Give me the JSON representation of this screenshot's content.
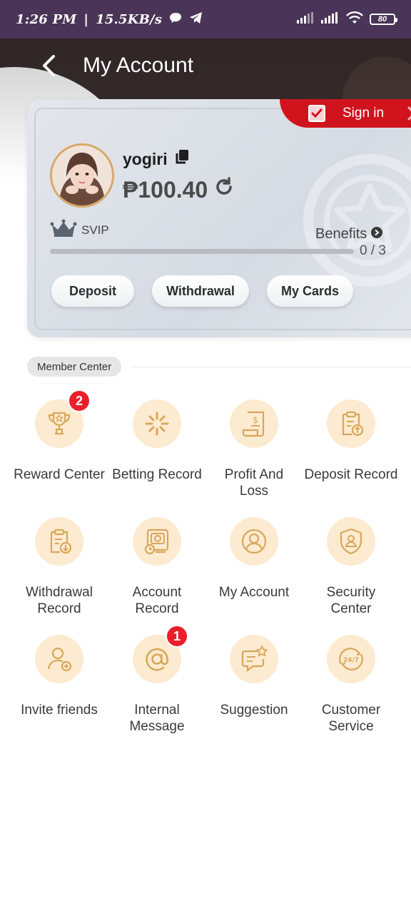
{
  "status_bar": {
    "time": "1:26 PM",
    "separator": "|",
    "speed": "15.5KB/s",
    "battery": "80"
  },
  "header": {
    "title": "My Account"
  },
  "card": {
    "sign_in": "Sign in",
    "username": "yogiri",
    "balance": "₱100.40",
    "vip_level": "SVIP",
    "benefits_label": "Benefits",
    "progress_text": "0 / 3",
    "progress_fraction": 0,
    "actions": {
      "deposit": "Deposit",
      "withdrawal": "Withdrawal",
      "my_cards": "My Cards"
    }
  },
  "member_center": {
    "title": "Member Center",
    "items": [
      {
        "label": "Reward Center",
        "icon": "trophy-icon",
        "badge": "2"
      },
      {
        "label": "Betting Record",
        "icon": "betting-record-icon",
        "badge": ""
      },
      {
        "label": "Profit And\nLoss",
        "icon": "profit-loss-icon",
        "badge": ""
      },
      {
        "label": "Deposit Record",
        "icon": "deposit-record-icon",
        "badge": ""
      },
      {
        "label": "Withdrawal\nRecord",
        "icon": "withdrawal-record-icon",
        "badge": ""
      },
      {
        "label": "Account\nRecord",
        "icon": "account-record-icon",
        "badge": ""
      },
      {
        "label": "My Account",
        "icon": "user-circle-icon",
        "badge": ""
      },
      {
        "label": "Security\nCenter",
        "icon": "shield-icon",
        "badge": ""
      },
      {
        "label": "Invite friends",
        "icon": "invite-user-icon",
        "badge": ""
      },
      {
        "label": "Internal\nMessage",
        "icon": "at-sign-icon",
        "badge": "1"
      },
      {
        "label": "Suggestion",
        "icon": "suggestion-icon",
        "badge": ""
      },
      {
        "label": "Customer\nService",
        "icon": "support-24-7-icon",
        "badge": ""
      }
    ]
  },
  "colors": {
    "status_bar": "#4a3457",
    "header_dark": "#3b2f2f",
    "sign_in_red": "#d0131d",
    "icon_bg": "#fcebd0",
    "icon_stroke": "#d9a75a",
    "badge_red": "#e9202a"
  }
}
